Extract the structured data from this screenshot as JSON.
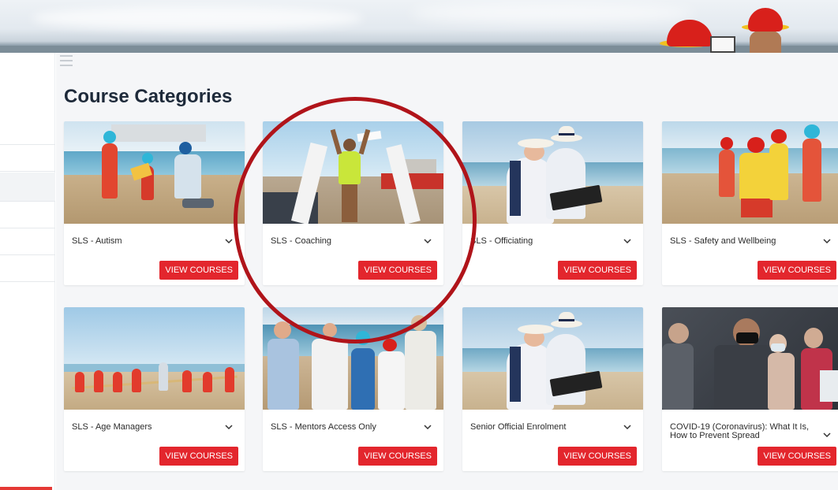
{
  "page": {
    "title": "Course Categories"
  },
  "cards": [
    {
      "name": "SLS - Autism",
      "button": "VIEW COURSES"
    },
    {
      "name": "SLS - Coaching",
      "button": "VIEW COURSES"
    },
    {
      "name": "SLS - Officiating",
      "button": "VIEW COURSES"
    },
    {
      "name": "SLS - Safety and Wellbeing",
      "button": "VIEW COURSES"
    },
    {
      "name": "SLS - Age Managers",
      "button": "VIEW COURSES"
    },
    {
      "name": "SLS - Mentors Access Only",
      "button": "VIEW COURSES"
    },
    {
      "name": "Senior Official Enrolment",
      "button": "VIEW COURSES"
    },
    {
      "name": "COVID-19 (Coronavirus): What It Is, How to Prevent Spread",
      "button": "VIEW COURSES"
    }
  ],
  "colors": {
    "accent": "#e3262d",
    "annotation": "#b0141a",
    "title": "#1e2a3a"
  }
}
